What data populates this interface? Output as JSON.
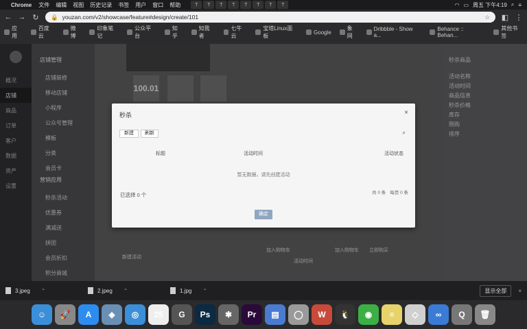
{
  "menubar": {
    "app": "Chrome",
    "menus": [
      "文件",
      "编辑",
      "视图",
      "历史记录",
      "书签",
      "用户",
      "窗口",
      "帮助"
    ],
    "clock": "周五 下午4:19"
  },
  "browser": {
    "url": "youzan.com/v2/showcase/feature#design/create/101",
    "bookmarks": [
      "应用",
      "百度云",
      "微博",
      "印象笔记",
      "公众平台",
      "知乎",
      "知我者",
      "七牛云",
      "宝塔Linux面板",
      "Google",
      "象网",
      "Dribbble - Show a...",
      "Behance :: Behan..."
    ],
    "other_bookmarks": "其他书签"
  },
  "page": {
    "leftnav": [
      "概况",
      "店铺",
      "商品",
      "订单",
      "客户",
      "数据",
      "资产",
      "设置"
    ],
    "subnav_group1": "店铺管理",
    "subnav_items1": [
      "店铺装修",
      "移动店铺",
      "小程序",
      "公众号管理",
      "模板",
      "分类",
      "会员卡"
    ],
    "subnav_group2": "营销应用",
    "subnav_items2": [
      "秒杀活动",
      "优惠券",
      "满减送",
      "拼团",
      "会员折扣",
      "积分商城"
    ],
    "tile_text": "100.01",
    "right_panel_title": "秒杀商品",
    "right_panel_rows": [
      "活动名称",
      "活动时间",
      "商品信息",
      "秒杀价格",
      "库存",
      "限购",
      "排序"
    ],
    "below": [
      "新建活动",
      "加入购物车",
      "活动时间",
      "加入购物车",
      "立即购买"
    ]
  },
  "modal": {
    "title": "秒杀",
    "new_label": "新建",
    "refresh_label": "刷新",
    "columns": [
      "标题",
      "活动时间",
      "活动状态"
    ],
    "empty_text": "暂无数据，请先创建活动",
    "selected": "已选择 0 个",
    "pager": [
      "共 0 条",
      "每页 0 条"
    ],
    "confirm": "确定"
  },
  "downloads": {
    "files": [
      "3.jpeg",
      "2.jpeg",
      "1.jpg"
    ],
    "show_all": "显示全部"
  },
  "dock": {
    "icons": [
      {
        "name": "finder-icon",
        "color": "#3b8fd9",
        "glyph": "☺"
      },
      {
        "name": "launchpad-icon",
        "color": "#888",
        "glyph": "🚀"
      },
      {
        "name": "app-store-icon",
        "color": "#2d8cf0",
        "glyph": "A"
      },
      {
        "name": "preview-icon",
        "color": "#6a8fb5",
        "glyph": "◈"
      },
      {
        "name": "safari-icon",
        "color": "#3a8fd8",
        "glyph": "◎"
      },
      {
        "name": "calendar-icon",
        "color": "#eeeeee",
        "glyph": "25"
      },
      {
        "name": "chrome-helper-icon",
        "color": "#555",
        "glyph": "G"
      },
      {
        "name": "photoshop-icon",
        "color": "#0b2a43",
        "glyph": "Ps"
      },
      {
        "name": "compressor-icon",
        "color": "#666",
        "glyph": "✱"
      },
      {
        "name": "premiere-icon",
        "color": "#2a0a3a",
        "glyph": "Pr"
      },
      {
        "name": "keynote-icon",
        "color": "#4a7bd0",
        "glyph": "▤"
      },
      {
        "name": "messages-icon",
        "color": "#9a9a9a",
        "glyph": "◯"
      },
      {
        "name": "wps-icon",
        "color": "#c84a3a",
        "glyph": "W"
      },
      {
        "name": "qq-icon",
        "color": "#333",
        "glyph": "🐧"
      },
      {
        "name": "wechat-icon",
        "color": "#3caf45",
        "glyph": "◉"
      },
      {
        "name": "notes-icon",
        "color": "#e7d36a",
        "glyph": "≡"
      },
      {
        "name": "sketch-icon",
        "color": "#d0d0d0",
        "glyph": "◇"
      },
      {
        "name": "baidu-netdisk-icon",
        "color": "#3a7bd5",
        "glyph": "∞"
      },
      {
        "name": "quicktime-icon",
        "color": "#777",
        "glyph": "Q"
      },
      {
        "name": "trash-icon",
        "color": "#888",
        "glyph": "🗑"
      }
    ]
  }
}
